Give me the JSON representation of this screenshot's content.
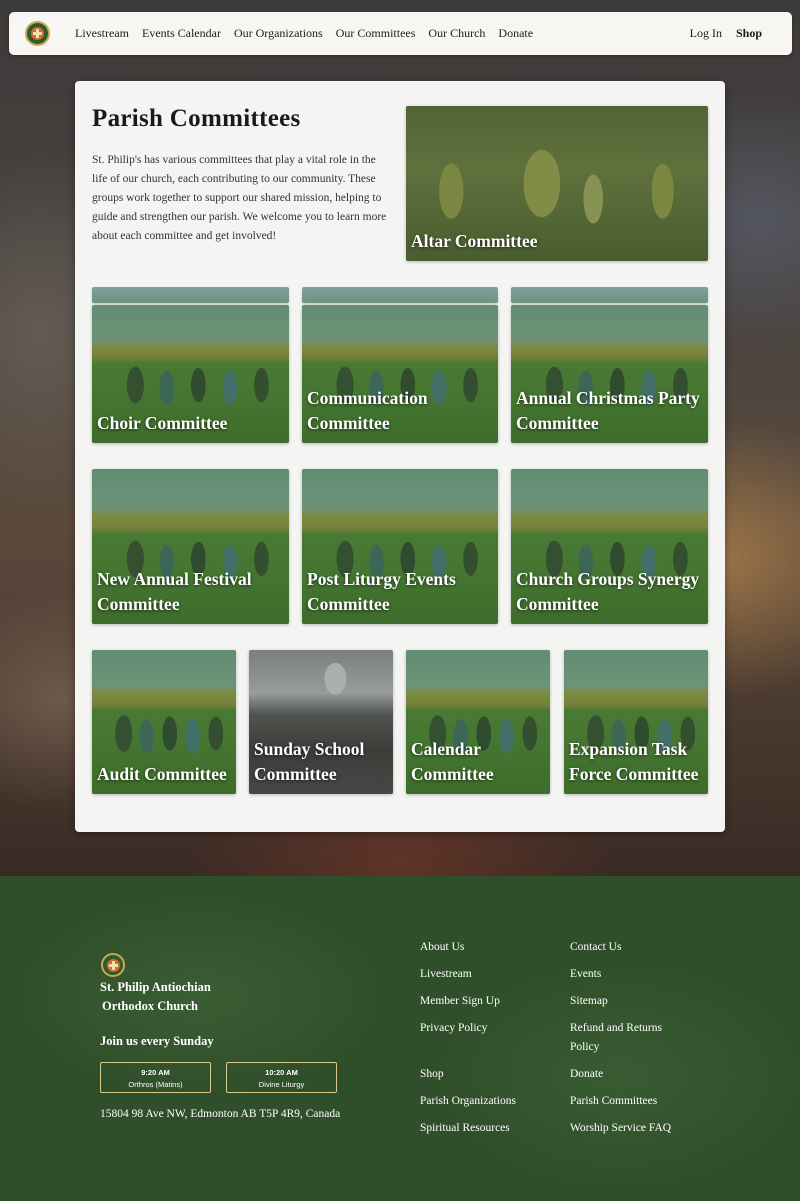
{
  "nav": {
    "links": [
      "Livestream",
      "Events Calendar",
      "Our Organizations",
      "Our Committees",
      "Our Church",
      "Donate"
    ],
    "login": "Log In",
    "shop": "Shop"
  },
  "page": {
    "title": "Parish Committees",
    "intro": "St. Philip's has various committees that play a vital role in the life of our church, each contributing to our community. These groups work together to support our shared mission, helping to guide and strengthen our parish. We welcome you to learn more about each committee and get involved!"
  },
  "committees": {
    "altar": "Altar Committee",
    "choir": "Choir Committee",
    "communication": "Communication Committee",
    "christmas": "Annual Christmas Party Committee",
    "festival": "New Annual Festival Committee",
    "post_liturgy": "Post Liturgy Events Committee",
    "synergy": "Church Groups Synergy Committee",
    "audit": "Audit Committee",
    "sunday_school": "Sunday School Committee",
    "calendar": "Calendar Committee",
    "expansion": "Expansion Task Force Committee"
  },
  "footer": {
    "church_name_line1": "St. Philip Antiochian",
    "church_name_line2": "Orthodox Church",
    "join": "Join us every Sunday",
    "services": [
      {
        "time": "9:20 AM",
        "name": "Orthros (Matins)"
      },
      {
        "time": "10:20 AM",
        "name": "Divine Liturgy"
      }
    ],
    "address": "15804 98 Ave NW, Edmonton AB T5P 4R9, Canada",
    "links_col1": [
      "About Us",
      "Livestream",
      "Member Sign Up",
      "Privacy Policy",
      "Shop",
      "Parish Organizations",
      "Spiritual Resources"
    ],
    "links_col2": [
      "Contact Us",
      "Events",
      "Sitemap",
      "Refund and Returns Policy",
      "Donate",
      "Parish Committees",
      "Worship Service FAQ"
    ]
  },
  "colors": {
    "accent_green": "#2f4f2a",
    "tile_tint": "#3c6e2d",
    "logo_gold": "#c9a850"
  }
}
